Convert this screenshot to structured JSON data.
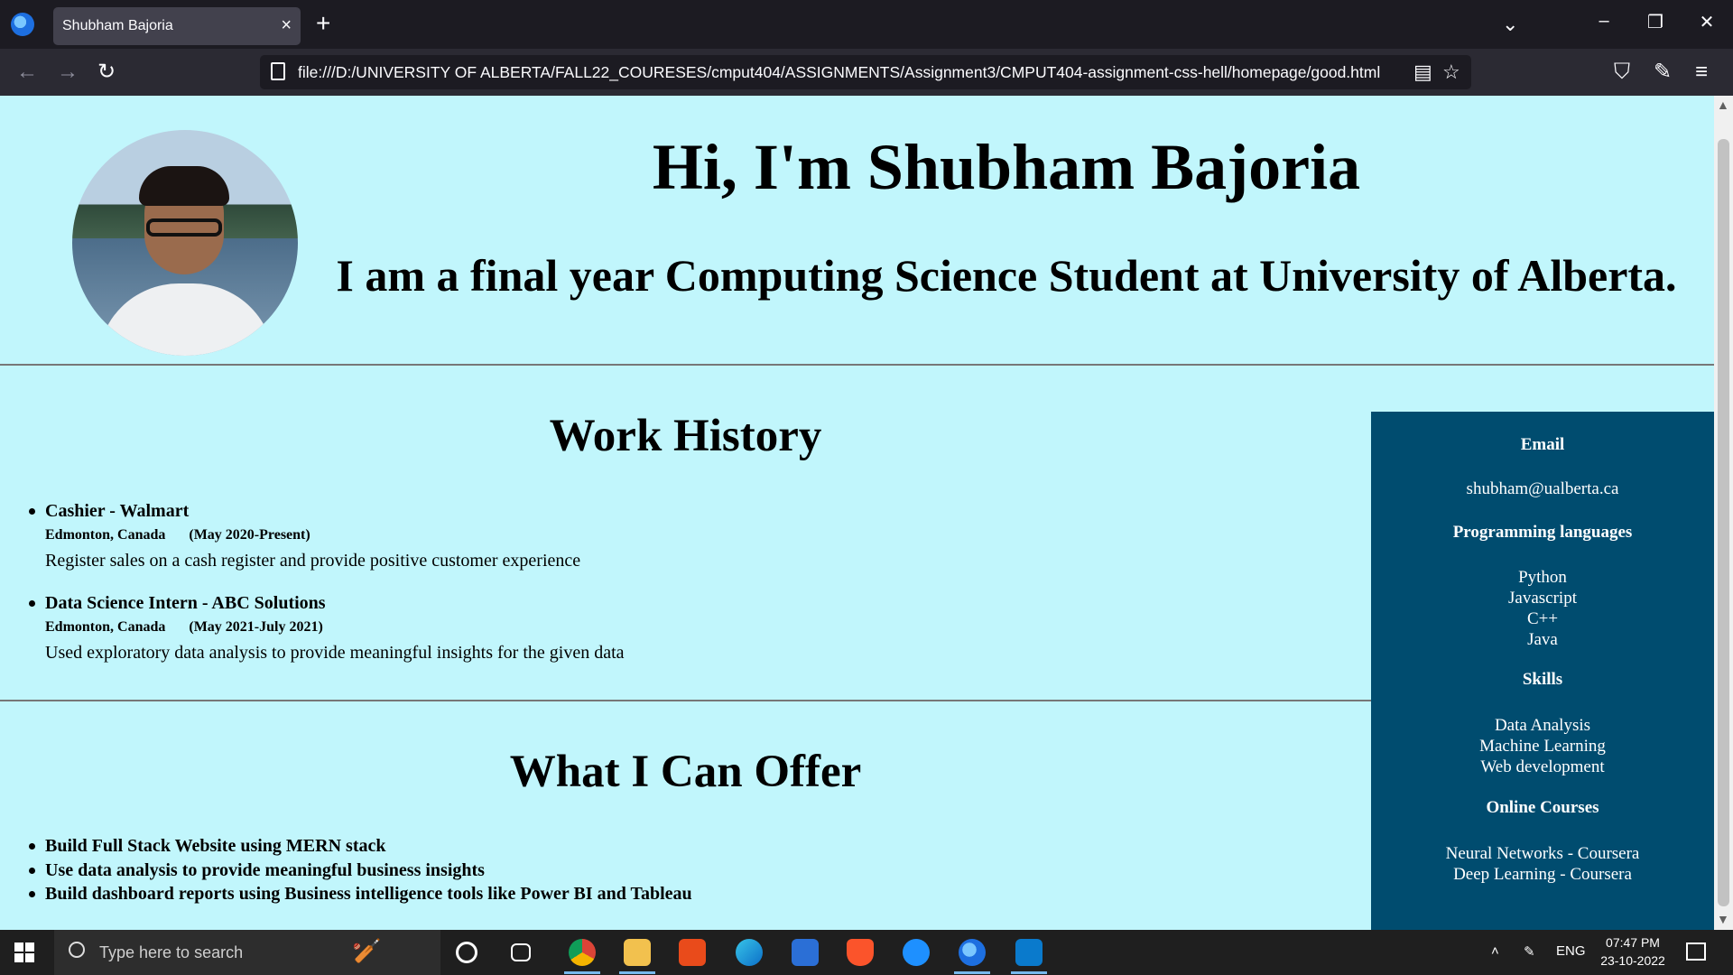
{
  "browser": {
    "tab_title": "Shubham Bajoria",
    "url": "file:///D:/UNIVERSITY OF ALBERTA/FALL22_COURESES/cmput404/ASSIGNMENTS/Assignment3/CMPUT404-assignment-css-hell/homepage/good.html"
  },
  "page": {
    "title": "Hi, I'm Shubham Bajoria",
    "subtitle": "I am a final year Computing Science Student at University of Alberta.",
    "work_history": {
      "heading": "Work History",
      "jobs": [
        {
          "title": "Cashier - Walmart",
          "location": "Edmonton, Canada",
          "dates": "(May 2020-Present)",
          "description": "Register sales on a cash register and provide positive customer experience"
        },
        {
          "title": "Data Science Intern - ABC Solutions",
          "location": "Edmonton, Canada",
          "dates": "(May 2021-July 2021)",
          "description": "Used exploratory data analysis to provide meaningful insights for the given data"
        }
      ]
    },
    "offer": {
      "heading": "What I Can Offer",
      "items": [
        "Build Full Stack Website using MERN stack",
        "Use data analysis to provide meaningful business insights",
        "Build dashboard reports using Business intelligence tools like Power BI and Tableau"
      ]
    },
    "sidebar": {
      "email_heading": "Email",
      "email": "shubham@ualberta.ca",
      "languages_heading": "Programming languages",
      "languages": [
        "Python",
        "Javascript",
        "C++",
        "Java"
      ],
      "skills_heading": "Skills",
      "skills": [
        "Data Analysis",
        "Machine Learning",
        "Web development"
      ],
      "courses_heading": "Online Courses",
      "courses": [
        "Neural Networks - Coursera",
        "Deep Learning - Coursera"
      ]
    }
  },
  "taskbar": {
    "search_placeholder": "Type here to search",
    "language": "ENG",
    "time": "07:47 PM",
    "date": "23-10-2022"
  },
  "colors": {
    "page_background": "#c1f6fc",
    "sidebar_background": "#004c6f",
    "browser_dark": "#1c1b22"
  }
}
